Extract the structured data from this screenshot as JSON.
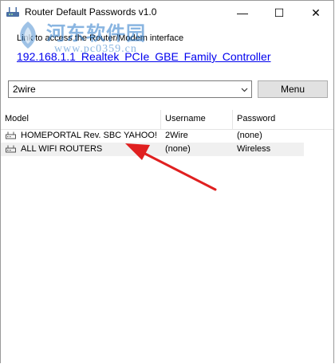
{
  "window": {
    "title": "Router Default Passwords v1.0",
    "minimize_glyph": "—",
    "maximize_glyph": "☐",
    "close_glyph": "✕"
  },
  "link_section": {
    "caption": "Link to access the Router/Modem interface",
    "value": "192.168.1.1   Realtek PCIe GBE Family Controller"
  },
  "brand_filter": {
    "selected": "2wire"
  },
  "menu_button": {
    "label": "Menu"
  },
  "table": {
    "columns": [
      "Model",
      "Username",
      "Password"
    ],
    "rows": [
      {
        "model": "HOMEPORTAL Rev. SBC YAHOO!...",
        "username": "2Wire",
        "password": "(none)"
      },
      {
        "model": "ALL WIFI ROUTERS",
        "username": "(none)",
        "password": "Wireless"
      }
    ]
  },
  "watermark": {
    "title": "河东软件园",
    "url": "www.pc0359.cn"
  },
  "colors": {
    "link": "#0000ee",
    "annotation_arrow": "#e02020",
    "watermark": "#2878c8"
  }
}
